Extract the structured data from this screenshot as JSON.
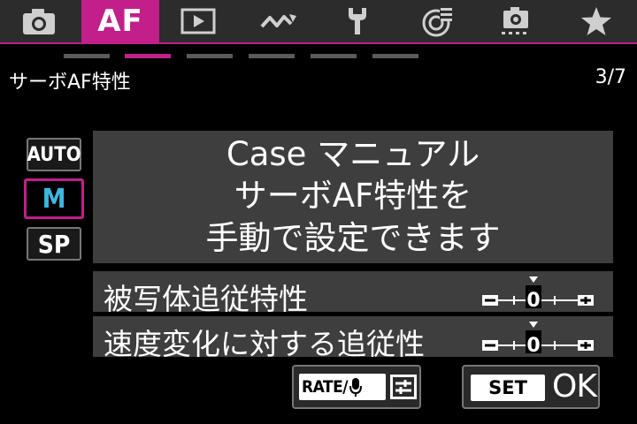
{
  "tabs": [
    {
      "name": "camera-icon"
    },
    {
      "name": "af-tab",
      "label": "AF"
    },
    {
      "name": "playback-icon"
    },
    {
      "name": "wireless-icon"
    },
    {
      "name": "wrench-icon"
    },
    {
      "name": "custom-functions-icon"
    },
    {
      "name": "camera-settings-icon"
    },
    {
      "name": "star-icon"
    }
  ],
  "active_tab": "AF",
  "accent_color": "#c21f8a",
  "header": {
    "title": "サーボAF特性",
    "page": "3/7"
  },
  "cases": [
    {
      "label": "AUTO",
      "selected": false
    },
    {
      "label": "M",
      "selected": true
    },
    {
      "label": "SP",
      "selected": false
    }
  ],
  "description": {
    "line1": "Case マニュアル",
    "line2": "サーボAF特性を",
    "line3": "手動で設定できます"
  },
  "params": [
    {
      "label": "被写体追従特性",
      "value": "0"
    },
    {
      "label": "速度変化に対する追従性",
      "value": "0"
    }
  ],
  "buttons": {
    "rate_label": "RATE/",
    "set_label": "SET",
    "ok_label": "OK"
  }
}
